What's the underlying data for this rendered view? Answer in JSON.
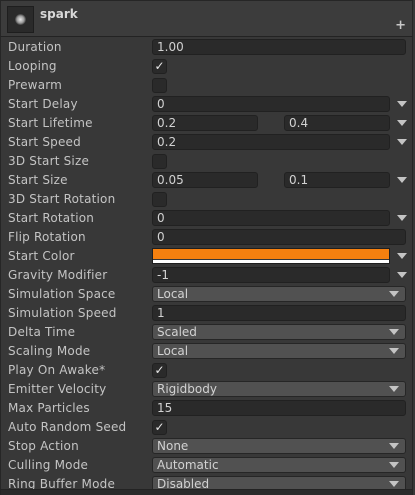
{
  "header": {
    "title": "spark",
    "add_icon": "plus-icon",
    "thumb_icon": "particle-icon"
  },
  "colors": {
    "start_color": "#f5800f"
  },
  "props": {
    "duration": {
      "label": "Duration",
      "value": "1.00"
    },
    "looping": {
      "label": "Looping",
      "checked": true
    },
    "prewarm": {
      "label": "Prewarm",
      "checked": false
    },
    "start_delay": {
      "label": "Start Delay",
      "value": "0"
    },
    "start_lifetime": {
      "label": "Start Lifetime",
      "min": "0.2",
      "max": "0.4"
    },
    "start_speed": {
      "label": "Start Speed",
      "value": "0.2"
    },
    "start_size_3d": {
      "label": "3D Start Size",
      "checked": false
    },
    "start_size": {
      "label": "Start Size",
      "min": "0.05",
      "max": "0.1"
    },
    "start_rotation_3d": {
      "label": "3D Start Rotation",
      "checked": false
    },
    "start_rotation": {
      "label": "Start Rotation",
      "value": "0"
    },
    "flip_rotation": {
      "label": "Flip Rotation",
      "value": "0"
    },
    "start_color": {
      "label": "Start Color"
    },
    "gravity_modifier": {
      "label": "Gravity Modifier",
      "value": "-1"
    },
    "simulation_space": {
      "label": "Simulation Space",
      "value": "Local"
    },
    "simulation_speed": {
      "label": "Simulation Speed",
      "value": "1"
    },
    "delta_time": {
      "label": "Delta Time",
      "value": "Scaled"
    },
    "scaling_mode": {
      "label": "Scaling Mode",
      "value": "Local"
    },
    "play_on_awake": {
      "label": "Play On Awake*",
      "checked": true
    },
    "emitter_velocity": {
      "label": "Emitter Velocity",
      "value": "Rigidbody"
    },
    "max_particles": {
      "label": "Max Particles",
      "value": "15"
    },
    "auto_random_seed": {
      "label": "Auto Random Seed",
      "checked": true
    },
    "stop_action": {
      "label": "Stop Action",
      "value": "None"
    },
    "culling_mode": {
      "label": "Culling Mode",
      "value": "Automatic"
    },
    "ring_buffer_mode": {
      "label": "Ring Buffer Mode",
      "value": "Disabled"
    }
  }
}
